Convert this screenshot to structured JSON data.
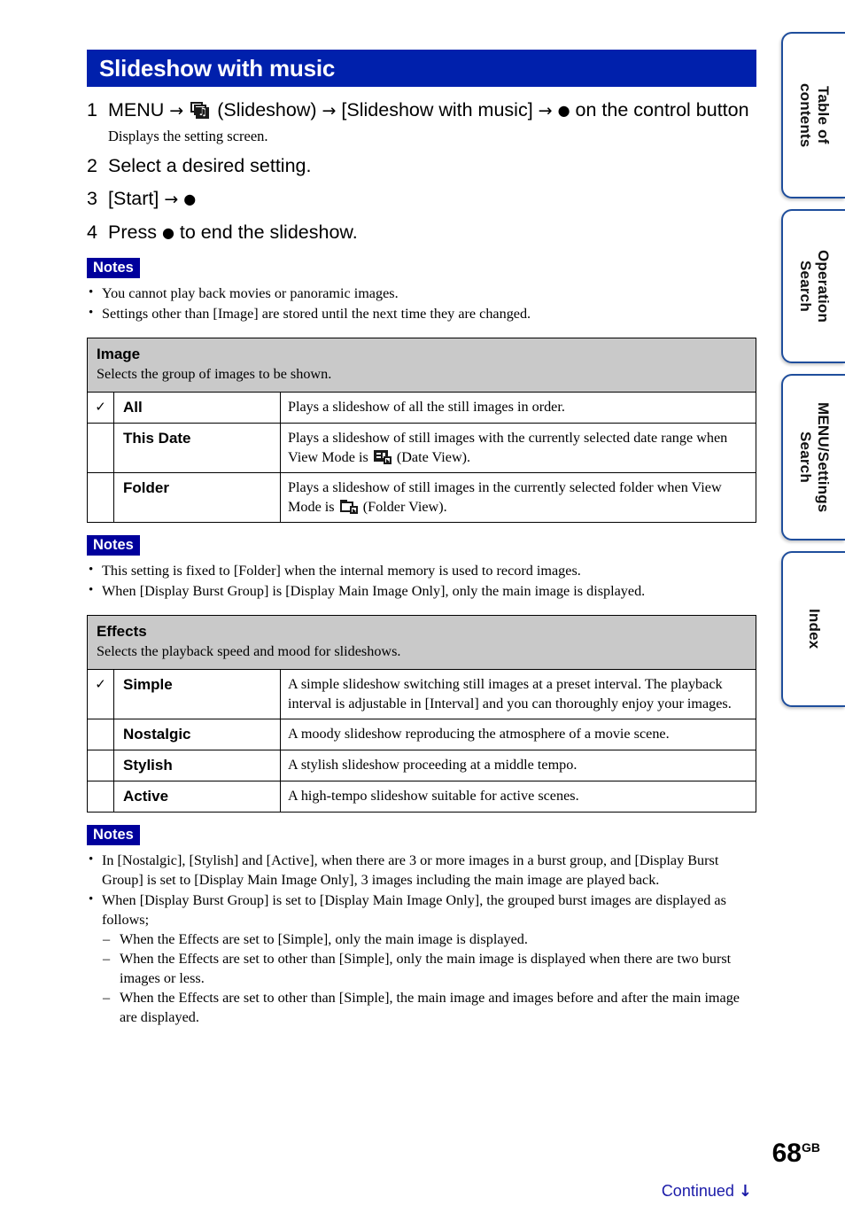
{
  "header": {
    "title": "Slideshow with music"
  },
  "steps": [
    {
      "num": "1",
      "pre": "MENU",
      "arrow1": "→",
      "icon": "slideshow-music-icon",
      "mid": "(Slideshow)",
      "arrow2": "→",
      "target": "[Slideshow with music]",
      "arrow3": "→",
      "dot": "●",
      "post": "on the control button",
      "sub": "Displays the setting screen."
    },
    {
      "num": "2",
      "text": "Select a desired setting.",
      "sub": ""
    },
    {
      "num": "3",
      "text": "[Start]",
      "arrow": "→",
      "dot": "●",
      "sub": ""
    },
    {
      "num": "4",
      "pre": "Press",
      "dot": "●",
      "post": "to end the slideshow.",
      "sub": ""
    }
  ],
  "notes_label": "Notes",
  "notes_1": [
    "You cannot play back movies or panoramic images.",
    "Settings other than [Image] are stored until the next time they are changed."
  ],
  "table_image": {
    "title": "Image",
    "description": "Selects the group of images to be shown.",
    "check_glyph": "✓",
    "rows": [
      {
        "checked": true,
        "name": "All",
        "desc": "Plays a slideshow of all the still images in order."
      },
      {
        "checked": false,
        "name": "This Date",
        "desc_before": "Plays a slideshow of still images with the currently selected date range when View Mode is",
        "icon": "date-view-icon",
        "desc_after": "(Date View)."
      },
      {
        "checked": false,
        "name": "Folder",
        "desc_before": "Plays a slideshow of still images in the currently selected folder when View Mode is",
        "icon": "folder-view-icon",
        "desc_after": "(Folder View)."
      }
    ]
  },
  "notes_2": [
    "This setting is fixed to [Folder] when the internal memory is used to record images.",
    "When [Display Burst Group] is [Display Main Image Only], only the main image is displayed."
  ],
  "table_effects": {
    "title": "Effects",
    "description": "Selects the playback speed and mood for slideshows.",
    "check_glyph": "✓",
    "rows": [
      {
        "checked": true,
        "name": "Simple",
        "desc": "A simple slideshow switching still images at a preset interval. The playback interval is adjustable in [Interval] and you can thoroughly enjoy your images."
      },
      {
        "checked": false,
        "name": "Nostalgic",
        "desc": "A moody slideshow reproducing the atmosphere of a movie scene."
      },
      {
        "checked": false,
        "name": "Stylish",
        "desc": "A stylish slideshow proceeding at a middle tempo."
      },
      {
        "checked": false,
        "name": "Active",
        "desc": "A high-tempo slideshow suitable for active scenes."
      }
    ]
  },
  "notes_3": {
    "items": [
      "In [Nostalgic], [Stylish] and [Active], when there are 3 or more images in a burst group, and [Display Burst Group] is set to [Display Main Image Only], 3 images including the main image are played back.",
      "When [Display Burst Group] is set to [Display Main Image Only], the grouped burst images are displayed as follows;"
    ],
    "sub_items": [
      "When the Effects are set to [Simple], only the main image is displayed.",
      "When the Effects are set to other than [Simple], only the main image is displayed when there are two burst images or less.",
      "When the Effects are set to other than [Simple], the main image and images before and after the main image are displayed."
    ]
  },
  "side_tabs": [
    {
      "label": "Table of\ncontents",
      "name": "tab-table-of-contents"
    },
    {
      "label": "Operation\nSearch",
      "name": "tab-operation-search"
    },
    {
      "label": "MENU/Settings\nSearch",
      "name": "tab-menu-settings-search"
    },
    {
      "label": "Index",
      "name": "tab-index"
    }
  ],
  "footer": {
    "page_number": "68",
    "page_suffix": "GB",
    "continued": "Continued",
    "continued_arrow": "↓"
  },
  "colors": {
    "title_bar": "#0020ac",
    "notes_badge": "#00009c",
    "table_header": "#c9c9c9",
    "tab_border": "#1f4e9c",
    "continued_link": "#1a1aa8"
  }
}
